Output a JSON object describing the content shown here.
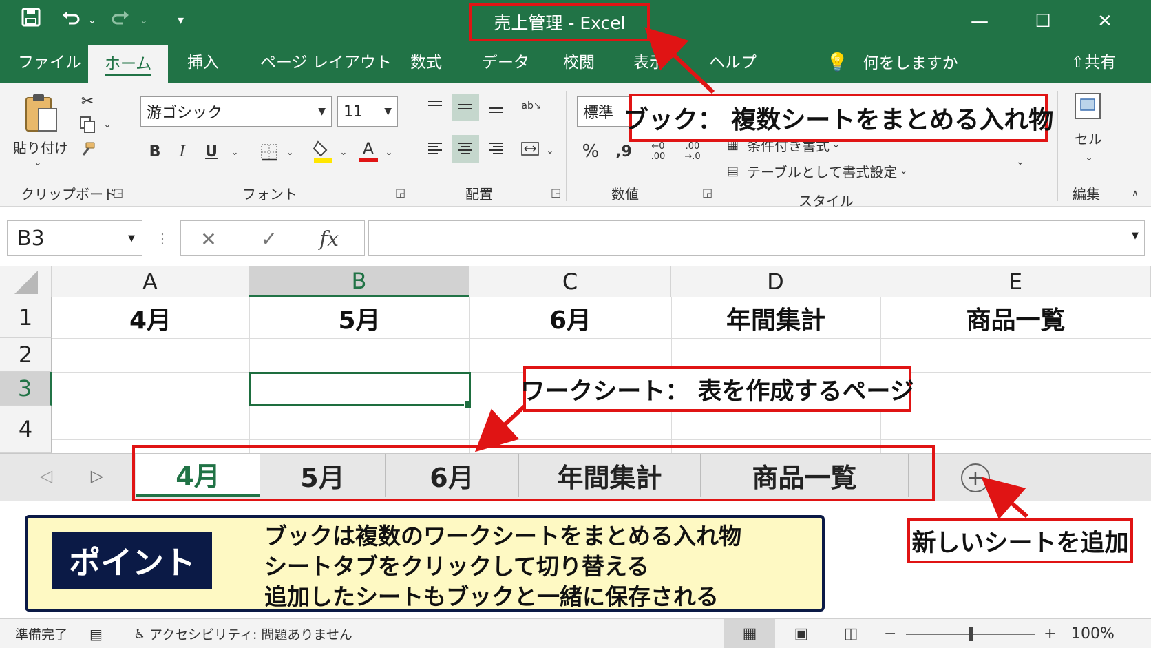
{
  "titlebar": {
    "title": "売上管理 - Excel",
    "icons": [
      "save-icon",
      "undo-icon",
      "redo-icon",
      "customize-qat-icon"
    ],
    "window_controls": [
      "minimize-icon",
      "maximize-icon",
      "close-icon"
    ]
  },
  "menu": {
    "tabs": [
      "ファイル",
      "ホーム",
      "挿入",
      "ページ レイアウト",
      "数式",
      "データ",
      "校閲",
      "表示",
      "ヘルプ"
    ],
    "active": "ホーム",
    "tell_me": "何をしますか",
    "share": "共有"
  },
  "ribbon": {
    "clipboard": {
      "paste": "貼り付け",
      "label": "クリップボード"
    },
    "font": {
      "name": "游ゴシック",
      "size": "11",
      "label": "フォント",
      "bold": "B",
      "italic": "I",
      "underline": "U",
      "font_color": "A",
      "font_color_hex": "#e01414",
      "highlight_hex": "#ffe600"
    },
    "alignment": {
      "label": "配置"
    },
    "number": {
      "format": "標準",
      "label": "数値",
      "percent": "%",
      "comma": "9",
      "inc_decimal_top": "←0",
      "inc_decimal_bottom": ".00",
      "dec_decimal_top": ".00",
      "dec_decimal_bottom": "→.0"
    },
    "styles": {
      "conditional": "条件付き書式",
      "table": "テーブルとして書式設定",
      "label": "スタイル"
    },
    "cells": {
      "label": "セル"
    },
    "editing": {
      "label": "編集"
    }
  },
  "callouts": {
    "book": "ブック： 複数シートをまとめる入れ物",
    "worksheet": "ワークシート： 表を作成するページ",
    "new_sheet": "新しいシートを追加"
  },
  "formula_bar": {
    "name_box": "B3",
    "cancel": "✕",
    "enter": "✓",
    "fx": "fx",
    "value": ""
  },
  "grid": {
    "columns": [
      "A",
      "B",
      "C",
      "D",
      "E"
    ],
    "rows": [
      "1",
      "2",
      "3",
      "4"
    ],
    "row1": [
      "4月",
      "5月",
      "6月",
      "年間集計",
      "商品一覧"
    ],
    "selected_col": "B",
    "selected_row": "3"
  },
  "sheets": {
    "tabs": [
      "4月",
      "5月",
      "6月",
      "年間集計",
      "商品一覧"
    ],
    "active": "4月",
    "add": "+"
  },
  "point": {
    "label": "ポイント",
    "lines": [
      "ブックは複数のワークシートをまとめる入れ物",
      "シートタブをクリックして切り替える",
      "追加したシートもブックと一緒に保存される"
    ]
  },
  "status": {
    "ready": "準備完了",
    "accessibility": "アクセシビリティ: 問題ありません",
    "zoom": "100%",
    "zoom_level": 0.5
  },
  "colors": {
    "excel_green": "#217346",
    "annotation_red": "#e01414",
    "point_bg": "#fef9c3",
    "point_navy": "#0b1a46"
  }
}
